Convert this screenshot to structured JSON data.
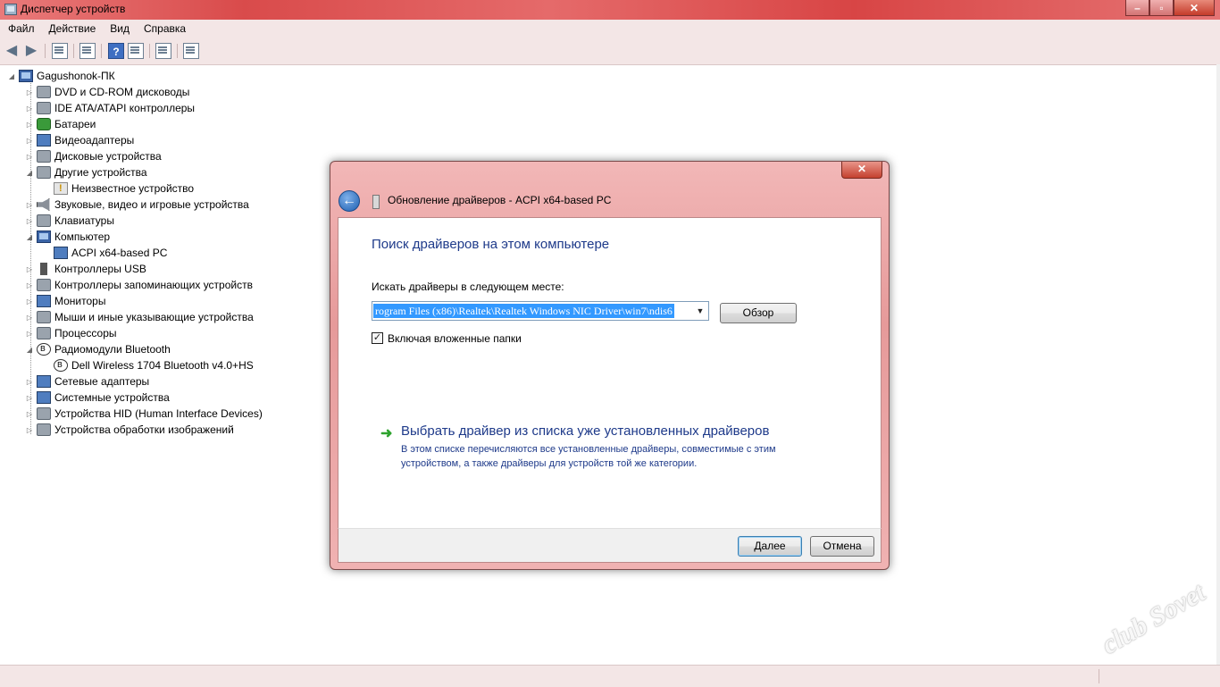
{
  "window": {
    "title": "Диспетчер устройств",
    "min": "–",
    "max": "▫",
    "close": "✕"
  },
  "menu": [
    "Файл",
    "Действие",
    "Вид",
    "Справка"
  ],
  "toolbar": {
    "back": "◀",
    "forward": "▶",
    "help": "?"
  },
  "tree": {
    "root": "Gagushonok-ПК",
    "items": [
      "DVD и CD-ROM дисководы",
      "IDE ATA/ATAPI контроллеры",
      "Батареи",
      "Видеоадаптеры",
      "Дисковые устройства",
      "Другие устройства",
      "Неизвестное устройство",
      "Звуковые, видео и игровые устройства",
      "Клавиатуры",
      "Компьютер",
      "ACPI x64-based PC",
      "Контроллеры USB",
      "Контроллеры запоминающих устройств",
      "Мониторы",
      "Мыши и иные указывающие устройства",
      "Процессоры",
      "Радиомодули Bluetooth",
      "Dell Wireless 1704 Bluetooth v4.0+HS",
      "Сетевые адаптеры",
      "Системные устройства",
      "Устройства HID (Human Interface Devices)",
      "Устройства обработки изображений"
    ],
    "expand_collapsed": "▷",
    "expand_open": "◢"
  },
  "dialog": {
    "title": "Обновление драйверов - ACPI x64-based PC",
    "close": "✕",
    "back": "←",
    "heading": "Поиск драйверов на этом компьютере",
    "search_label": "Искать драйверы в следующем месте:",
    "path_value": "rogram Files (x86)\\Realtek\\Realtek Windows NIC Driver\\win7\\ndis6",
    "dropdown_arrow": "▼",
    "browse_button": "Обзор",
    "include_subfolders_checked": true,
    "check_mark": "✓",
    "include_subfolders_label": "Включая вложенные папки",
    "link_arrow": "➜",
    "pick_driver_title": "Выбрать драйвер из списка уже установленных драйверов",
    "pick_driver_desc": "В этом списке перечисляются все установленные драйверы, совместимые с этим устройством, а также драйверы для устройств той же категории.",
    "next_button": "Далее",
    "cancel_button": "Отмена"
  },
  "watermark": "club Sovet",
  "colors": {
    "titlebar": "#d94b4b",
    "dialog_frame": "#e69a9a",
    "link": "#1e3a8a",
    "selection": "#3399ff"
  }
}
